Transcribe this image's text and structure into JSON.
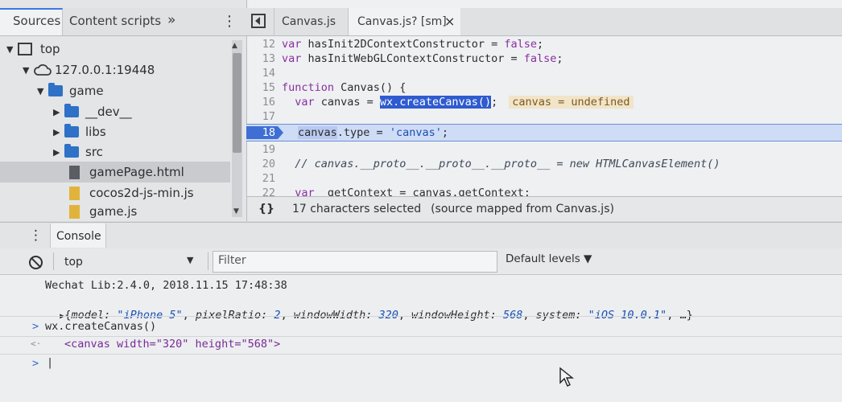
{
  "left_tabs": {
    "sources": "Sources",
    "content_scripts": "Content scripts",
    "more": "»"
  },
  "tree": {
    "top": "top",
    "origin": "127.0.0.1:19448",
    "game": "game",
    "dev": "__dev__",
    "libs": "libs",
    "src": "src",
    "gamepage": "gamePage.html",
    "cocos": "cocos2d-js-min.js",
    "gamejs": "game.js"
  },
  "editor_tabs": {
    "tab1": "Canvas.js",
    "tab2": "Canvas.js? [sm]",
    "close": "×"
  },
  "code": {
    "l12_num": "12",
    "l12_a": "var",
    "l12_b": " hasInit2DContextConstructor = ",
    "l12_c": "false",
    "l12_d": ";",
    "l13_num": "13",
    "l13_a": "var",
    "l13_b": " hasInitWebGLContextConstructor = ",
    "l13_c": "false",
    "l13_d": ";",
    "l14_num": "14",
    "l15_num": "15",
    "l15_a": "function",
    "l15_b": " Canvas() {",
    "l16_num": "16",
    "l16_a": "  var",
    "l16_b": " canvas = ",
    "l16_sel": "wx.createCanvas()",
    "l16_c": ";",
    "l16_inline": "canvas = undefined",
    "l17_num": "17",
    "l18_num": "18",
    "l18_a": "canvas",
    "l18_b": ".type = ",
    "l18_c": "'canvas'",
    "l18_d": ";",
    "l19_num": "19",
    "l20_num": "20",
    "l20_a": "  // canvas.__proto__.__proto__.__proto__ = new HTMLCanvasElement()",
    "l21_num": "21",
    "l22_num": "22",
    "l22_a": "  var",
    "l22_b": " _getContext = canvas.getContext;"
  },
  "status": {
    "braces": "{}",
    "selected": "17 characters selected",
    "mapped": "(source mapped from Canvas.js)"
  },
  "console": {
    "tab": "Console",
    "context": "top",
    "filter_placeholder": "Filter",
    "levels": "Default levels ▼",
    "line1": "Wechat Lib:2.4.0, 2018.11.15 17:48:38",
    "obj_open": "{",
    "k1": "model:",
    "v1": " \"iPhone 5\"",
    "s1": ", ",
    "k2": "pixelRatio:",
    "v2": " 2",
    "s2": ", ",
    "k3": "windowWidth:",
    "v3": " 320",
    "s3": ", ",
    "k4": "windowHeight:",
    "v4": " 568",
    "s4": ", ",
    "k5": "system:",
    "v5": " \"iOS 10.0.1\"",
    "obj_close": ", …}",
    "input_prompt": ">",
    "input_cmd": "wx.createCanvas()",
    "output_arrow": "<·",
    "output_html": "<canvas width=\"320\" height=\"568\">",
    "caret": ">",
    "cursor": "|"
  }
}
